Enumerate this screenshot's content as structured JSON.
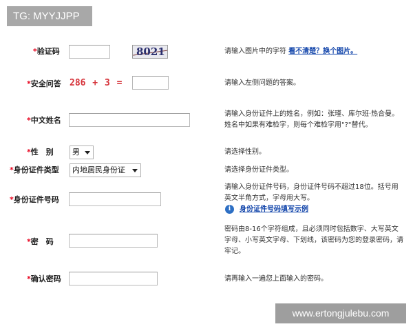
{
  "overlay": {
    "tag": "TG: MYYJJPP",
    "watermark": "www.ertongjulebu.com"
  },
  "form": {
    "captcha": {
      "required": "*",
      "label": "验证码",
      "value": "",
      "image_text": "8021",
      "hint": "请输入图片中的字符",
      "refresh_link": "看不清楚？换个图片。"
    },
    "security_question": {
      "required": "*",
      "label": "安全问答",
      "question": "286 + 3 =",
      "value": "",
      "hint": "请输入左侧问题的答案。"
    },
    "chinese_name": {
      "required": "*",
      "label": "中文姓名",
      "value": "",
      "hint": "请输入身份证件上的姓名，例如：张瑾、库尔班·热合曼。姓名中如果有难检字，则每个难检字用\"?\"替代。"
    },
    "gender": {
      "required": "*",
      "label": "性　别",
      "selected": "男",
      "hint": "请选择性别。"
    },
    "id_type": {
      "required": "*",
      "label": "身份证件类型",
      "selected": "内地居民身份证",
      "hint": "请选择身份证件类型。"
    },
    "id_number": {
      "required": "*",
      "label": "身份证件号码",
      "value": "",
      "hint": "请输入身份证件号码，身份证件号码不超过18位。括号用英文半角方式，字母用大写。",
      "example_link": "身份证件号码填写示例"
    },
    "password": {
      "required": "*",
      "label": "密　码",
      "value": "",
      "hint": "密码由8-16个字符组成，且必须同时包括数字、大写英文字母、小写英文字母、下划线，该密码为您的登录密码，请牢记。"
    },
    "confirm_password": {
      "required": "*",
      "label": "确认密码",
      "value": "",
      "hint": "请再输入一遍您上面输入的密码。"
    }
  }
}
